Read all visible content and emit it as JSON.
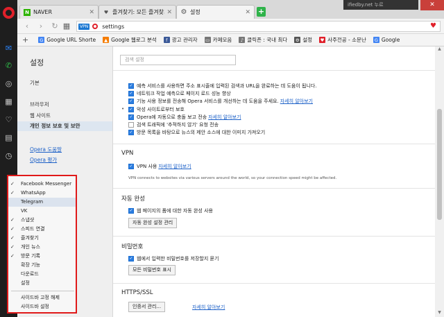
{
  "tabs": [
    {
      "icon": "naver-icon",
      "label": "NAVER",
      "icon_text": "N"
    },
    {
      "icon": "heart-icon",
      "label": "즐겨찾기: 모든 즐겨찾기"
    },
    {
      "icon": "gear-icon",
      "label": "설정"
    }
  ],
  "background_window_text": "ifiedby.net 누르",
  "address": {
    "url": "settings",
    "vpn_badge": "VPN"
  },
  "bookmarks": [
    {
      "label": "Google URL Shorte",
      "color": "#4285f4",
      "glyph": "G"
    },
    {
      "label": "Google 웹로그 분석",
      "color": "#f57c00",
      "glyph": "▲"
    },
    {
      "label": "광고 관리자",
      "color": "#3b5998",
      "glyph": "f"
    },
    {
      "label": "카페모음",
      "color": "#777777",
      "glyph": "▭"
    },
    {
      "label": "클릭픈 : 국내 최다",
      "color": "#777777",
      "glyph": "♪"
    },
    {
      "label": "설정",
      "color": "#555555",
      "glyph": "⚙"
    },
    {
      "label": "사주전공 - 소문난",
      "color": "#e0202a",
      "glyph": "♥"
    },
    {
      "label": "Google",
      "color": "#4285f4",
      "glyph": "G"
    }
  ],
  "side": {
    "title": "설정",
    "nav": [
      "기본",
      "브라우저",
      "웹 사이트",
      "개인 정보 보호 및 보안"
    ],
    "links": [
      "Opera 도움말",
      "Opera 평가"
    ]
  },
  "popup": {
    "items": [
      {
        "label": "Facebook Messenger",
        "checked": "✓"
      },
      {
        "label": "WhatsApp",
        "checked": "✓"
      },
      {
        "label": "Telegram",
        "checked": ""
      },
      {
        "label": "VK",
        "checked": ""
      },
      {
        "label": "스냅샷",
        "checked": "✓"
      },
      {
        "label": "스피드 연결",
        "checked": "✓"
      },
      {
        "label": "즐겨찾기",
        "checked": "✓"
      },
      {
        "label": "개인 뉴스",
        "checked": "✓"
      },
      {
        "label": "방문 기록",
        "checked": "✓"
      },
      {
        "label": "확장 기능",
        "checked": ""
      },
      {
        "label": "다운로드",
        "checked": ""
      },
      {
        "label": "설정",
        "checked": ""
      },
      {
        "label": "사이드바 고정 해제",
        "checked": ""
      },
      {
        "label": "사이드바 설정",
        "checked": ""
      }
    ]
  },
  "main": {
    "search_placeholder": "검색 설정",
    "privacy_rows": [
      {
        "label": "예측 서비스를 사용하면 주소 표시줄에 입력된 검색과 URL을 완료하는 데 도움이 됩니다.",
        "checked": true,
        "link": ""
      },
      {
        "label": "네트워크 작업 예측으로 페이지 로드 성능 향상",
        "checked": true,
        "link": ""
      },
      {
        "label": "기능 사용 정보를 전송해 Opera 서비스를 개선하는 데 도움을 주세요.",
        "checked": true,
        "link": "자세히 알아보기"
      },
      {
        "label": "악성 사이트로부터 보호",
        "checked": true,
        "link": ""
      },
      {
        "label": "Opera에 자동으로 충돌 보고 전송",
        "checked": true,
        "link": "자세히 알아보기"
      },
      {
        "label": "검색 트래픽에 '추적하지 않기' 요청 전송",
        "checked": false,
        "link": ""
      },
      {
        "label": "방문 목록을 바탕으로 뉴스의 제안 소스에 대한 이미지 가져오기",
        "checked": true,
        "link": ""
      }
    ],
    "vpn": {
      "title": "VPN",
      "label": "VPN 사용",
      "link": "자세히 알아보기",
      "description": "VPN connects to websites via various servers around the world, so your connection speed might be affected."
    },
    "autofill": {
      "title": "자동 완성",
      "label": "웹 페이지의 폼에 대한 자동 완성 사용",
      "button": "자동 완성 설정 관리"
    },
    "password": {
      "title": "비밀번호",
      "label": "웹에서 입력한 비밀번호를 저장할지 묻기",
      "button": "모든 비밀번호 표시"
    },
    "https": {
      "title": "HTTPS/SSL",
      "button": "인증서 관리...",
      "link": "자세히 알아보기"
    }
  }
}
